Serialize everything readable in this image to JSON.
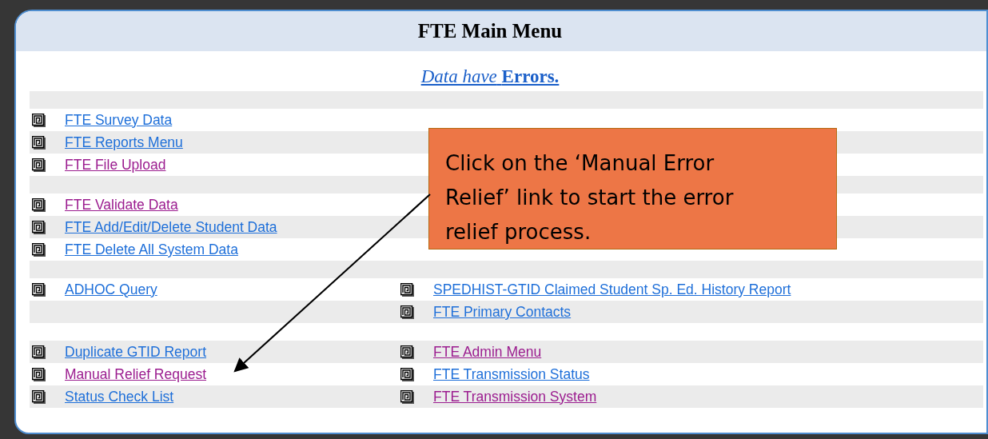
{
  "header": {
    "title": "FTE Main Menu"
  },
  "status": {
    "text": "*Data have* **Errors.**"
  },
  "rows": [
    {
      "kind": "spacer"
    },
    {
      "kind": "links",
      "left": {
        "label": "FTE Survey Data",
        "visited": false
      }
    },
    {
      "kind": "links",
      "left": {
        "label": "FTE Reports Menu",
        "visited": false
      }
    },
    {
      "kind": "links",
      "left": {
        "label": "FTE File Upload",
        "visited": true
      }
    },
    {
      "kind": "spacer"
    },
    {
      "kind": "links",
      "left": {
        "label": "FTE Validate Data",
        "visited": true
      }
    },
    {
      "kind": "links",
      "left": {
        "label": "FTE Add/Edit/Delete Student Data",
        "visited": false
      }
    },
    {
      "kind": "links",
      "left": {
        "label": "FTE Delete All System Data",
        "visited": false
      }
    },
    {
      "kind": "spacer"
    },
    {
      "kind": "links",
      "left": {
        "label": "ADHOC Query",
        "visited": false
      },
      "right": {
        "label": "SPEDHIST-GTID Claimed Student Sp. Ed. History Report",
        "visited": false
      }
    },
    {
      "kind": "links",
      "right": {
        "label": "FTE Primary Contacts",
        "visited": false
      }
    },
    {
      "kind": "spacer"
    },
    {
      "kind": "links",
      "left": {
        "label": "Duplicate GTID Report",
        "visited": false
      },
      "right": {
        "label": "FTE Admin Menu",
        "visited": true
      }
    },
    {
      "kind": "links",
      "left": {
        "label": "Manual Relief Request",
        "visited": true
      },
      "right": {
        "label": "FTE Transmission Status",
        "visited": false
      }
    },
    {
      "kind": "links",
      "left": {
        "label": "Status Check List",
        "visited": false
      },
      "right": {
        "label": "FTE Transmission System",
        "visited": true
      }
    }
  ],
  "callout": {
    "text": "Click on the ‘Manual Error Relief’ link to start the error relief process."
  }
}
